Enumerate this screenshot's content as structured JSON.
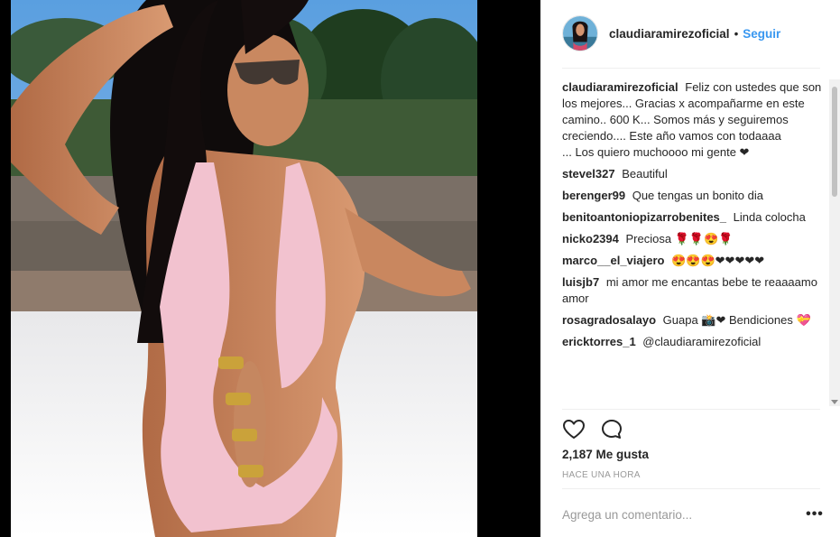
{
  "post": {
    "username": "claudiaramirezoficial",
    "dot": "•",
    "follow_label": "Seguir",
    "caption": "Feliz con ustedes que son los mejores... Gracias x acompañarme en este camino.. 600 K... Somos más y seguiremos creciendo.... Este año vamos con todaaaa\n... Los quiero muchoooo mi gente ❤",
    "likes": "2,187 Me gusta",
    "timestamp": "HACE UNA HORA",
    "comment_placeholder": "Agrega un comentario...",
    "more_label": "•••"
  },
  "comments": [
    {
      "user": "stevel327",
      "text": "Beautiful"
    },
    {
      "user": "berenger99",
      "text": "Que tengas un bonito dia"
    },
    {
      "user": "benitoantoniopizarrobenites_",
      "text": "Linda colocha"
    },
    {
      "user": "nicko2394",
      "text": "Preciosa 🌹🌹😍🌹"
    },
    {
      "user": "marco__el_viajero",
      "text": "😍😍😍❤❤❤❤❤"
    },
    {
      "user": "luisjb7",
      "text": "mi amor me encantas bebe te reaaaamo amor"
    },
    {
      "user": "rosagradosalayo",
      "text": "Guapa 📸❤ Bendiciones 💝"
    },
    {
      "user": "ericktorres_1",
      "text": "@claudiaramirezoficial"
    }
  ],
  "icons": {
    "heart": "heart-icon",
    "comment": "comment-icon",
    "more": "more-options-icon"
  },
  "colors": {
    "link_blue": "#3897f0",
    "text": "#262626",
    "muted": "#999999",
    "swimsuit_pink": "#f2c2cf"
  }
}
